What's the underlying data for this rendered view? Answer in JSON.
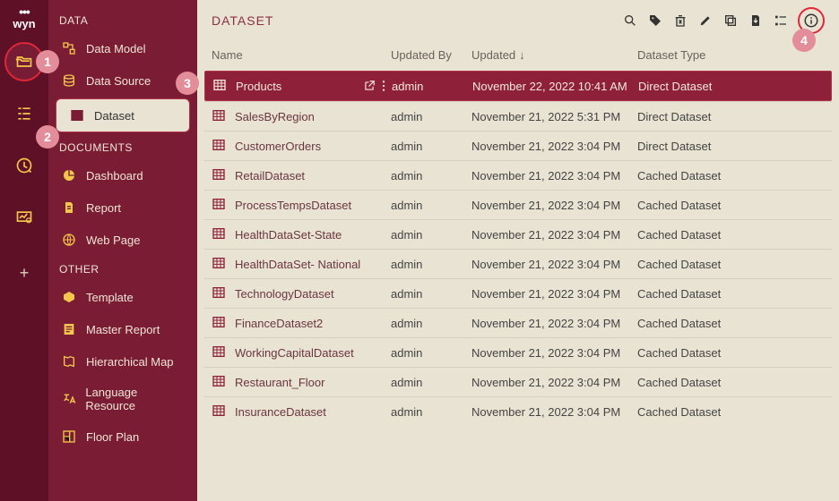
{
  "logo": "wyn",
  "callouts": {
    "c1": "1",
    "c2": "2",
    "c3": "3",
    "c4": "4"
  },
  "sidebar": {
    "section_data": "DATA",
    "section_docs": "DOCUMENTS",
    "section_other": "OTHER",
    "items": {
      "data_model": "Data Model",
      "data_source": "Data Source",
      "dataset": "Dataset",
      "dashboard": "Dashboard",
      "report": "Report",
      "web_page": "Web Page",
      "template": "Template",
      "master_report": "Master Report",
      "hierarchical_map": "Hierarchical Map",
      "language_resource": "Language Resource",
      "floor_plan": "Floor Plan"
    }
  },
  "header": {
    "title": "DATASET"
  },
  "columns": {
    "name": "Name",
    "updated_by": "Updated By",
    "updated": "Updated",
    "dataset_type": "Dataset Type",
    "sort_indicator": "↓"
  },
  "rows": [
    {
      "name": "Products",
      "updated_by": "admin",
      "updated": "November 22, 2022 10:41 AM",
      "type": "Direct Dataset",
      "selected": true
    },
    {
      "name": "SalesByRegion",
      "updated_by": "admin",
      "updated": "November 21, 2022 5:31 PM",
      "type": "Direct Dataset"
    },
    {
      "name": "CustomerOrders",
      "updated_by": "admin",
      "updated": "November 21, 2022 3:04 PM",
      "type": "Direct Dataset"
    },
    {
      "name": "RetailDataset",
      "updated_by": "admin",
      "updated": "November 21, 2022 3:04 PM",
      "type": "Cached Dataset"
    },
    {
      "name": "ProcessTempsDataset",
      "updated_by": "admin",
      "updated": "November 21, 2022 3:04 PM",
      "type": "Cached Dataset"
    },
    {
      "name": "HealthDataSet-State",
      "updated_by": "admin",
      "updated": "November 21, 2022 3:04 PM",
      "type": "Cached Dataset"
    },
    {
      "name": "HealthDataSet- National",
      "updated_by": "admin",
      "updated": "November 21, 2022 3:04 PM",
      "type": "Cached Dataset"
    },
    {
      "name": "TechnologyDataset",
      "updated_by": "admin",
      "updated": "November 21, 2022 3:04 PM",
      "type": "Cached Dataset"
    },
    {
      "name": "FinanceDataset2",
      "updated_by": "admin",
      "updated": "November 21, 2022 3:04 PM",
      "type": "Cached Dataset"
    },
    {
      "name": "WorkingCapitalDataset",
      "updated_by": "admin",
      "updated": "November 21, 2022 3:04 PM",
      "type": "Cached Dataset"
    },
    {
      "name": "Restaurant_Floor",
      "updated_by": "admin",
      "updated": "November 21, 2022 3:04 PM",
      "type": "Cached Dataset"
    },
    {
      "name": "InsuranceDataset",
      "updated_by": "admin",
      "updated": "November 21, 2022 3:04 PM",
      "type": "Cached Dataset"
    }
  ]
}
